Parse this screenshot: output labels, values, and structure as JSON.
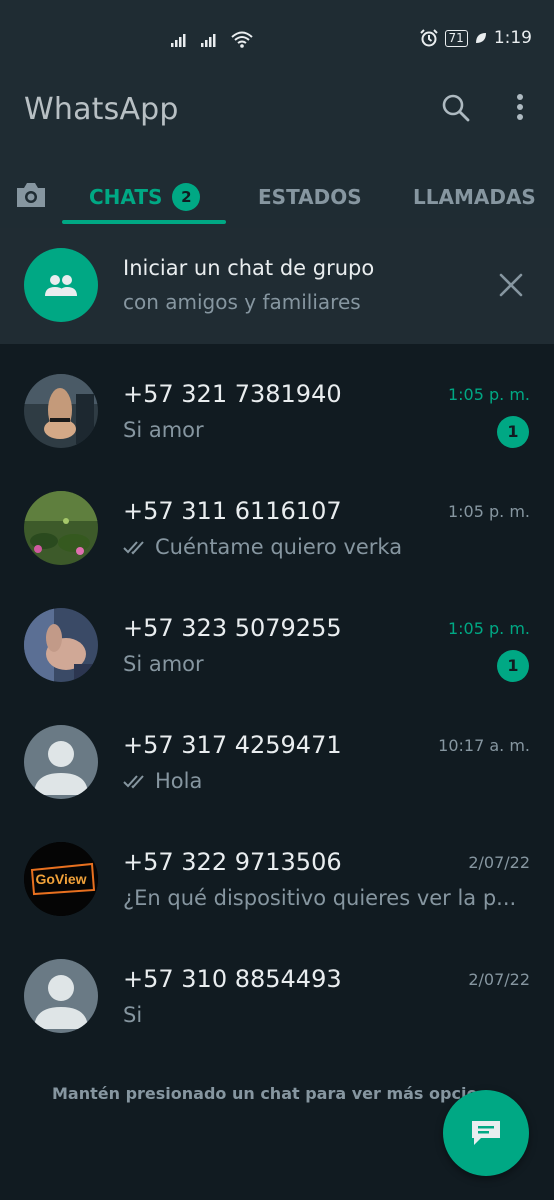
{
  "status_bar": {
    "time": "1:19",
    "battery": "71"
  },
  "header": {
    "title": "WhatsApp"
  },
  "tabs": [
    {
      "label": "CHATS",
      "badge": "2",
      "active": true
    },
    {
      "label": "ESTADOS",
      "active": false
    },
    {
      "label": "LLAMADAS",
      "active": false
    }
  ],
  "group_banner": {
    "title": "Iniciar un chat de grupo",
    "subtitle": "con amigos y familiares"
  },
  "chats": [
    {
      "name": "+57 321 7381940",
      "message": "Si amor",
      "time": "1:05 p. m.",
      "unread": "1",
      "read_ticks": false
    },
    {
      "name": "+57 311 6116107",
      "message": "Cuéntame quiero verka",
      "time": "1:05 p. m.",
      "read_ticks": true
    },
    {
      "name": "+57 323 5079255",
      "message": "Si amor",
      "time": "1:05 p. m.",
      "unread": "1",
      "read_ticks": false
    },
    {
      "name": "+57 317 4259471",
      "message": "Hola",
      "time": "10:17 a. m.",
      "read_ticks": true
    },
    {
      "name": "+57 322 9713506",
      "message": "¿En qué dispositivo quieres ver la p...",
      "time": "2/07/22",
      "read_ticks": false,
      "avatar_text": "GoView"
    },
    {
      "name": "+57 310 8854493",
      "message": "Si",
      "time": "2/07/22",
      "read_ticks": false
    }
  ],
  "footer_hint": "Mantén presionado un chat para ver más opcio",
  "colors": {
    "accent": "#00a884",
    "background": "#111b21",
    "header": "#1f2c33",
    "muted": "#8696a0"
  },
  "icons": [
    "camera-icon",
    "search-icon",
    "more-vert-icon",
    "group-icon",
    "close-icon",
    "chat-compose-icon",
    "double-check-icon"
  ]
}
